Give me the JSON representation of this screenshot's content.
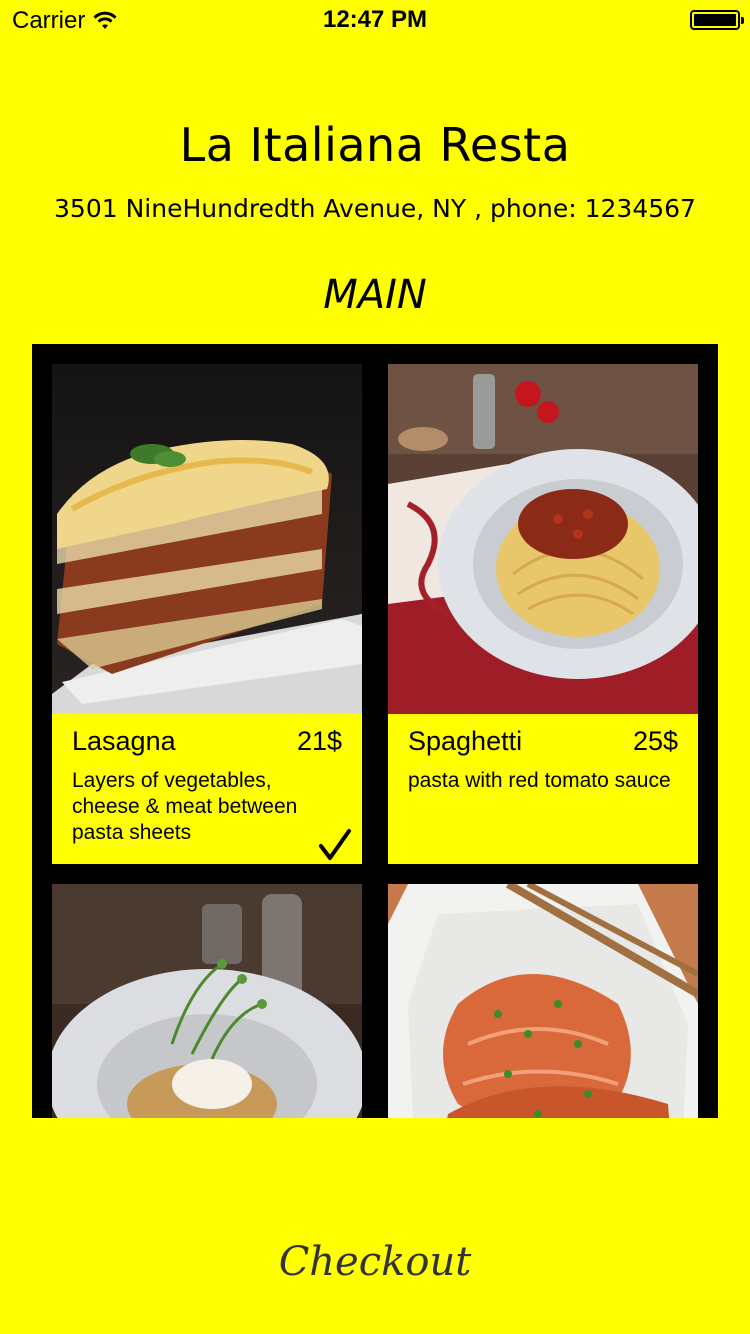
{
  "status_bar": {
    "carrier": "Carrier",
    "time": "12:47 PM"
  },
  "header": {
    "restaurant_name": "La Italiana Resta",
    "address": "3501 NineHundredth Avenue, NY , phone: 1234567"
  },
  "section": {
    "title": "MAIN"
  },
  "menu_items": [
    {
      "name": "Lasagna",
      "price": "21$",
      "description": "Layers of vegetables, cheese & meat between pasta sheets",
      "selected": true
    },
    {
      "name": "Spaghetti",
      "price": "25$",
      "description": "pasta with red tomato sauce",
      "selected": false
    },
    {
      "name": "",
      "price": "",
      "description": "",
      "selected": false
    },
    {
      "name": "",
      "price": "",
      "description": "",
      "selected": false
    }
  ],
  "checkout": {
    "label": "Checkout"
  },
  "colors": {
    "background": "#ffff00",
    "grid_background": "#000000"
  }
}
